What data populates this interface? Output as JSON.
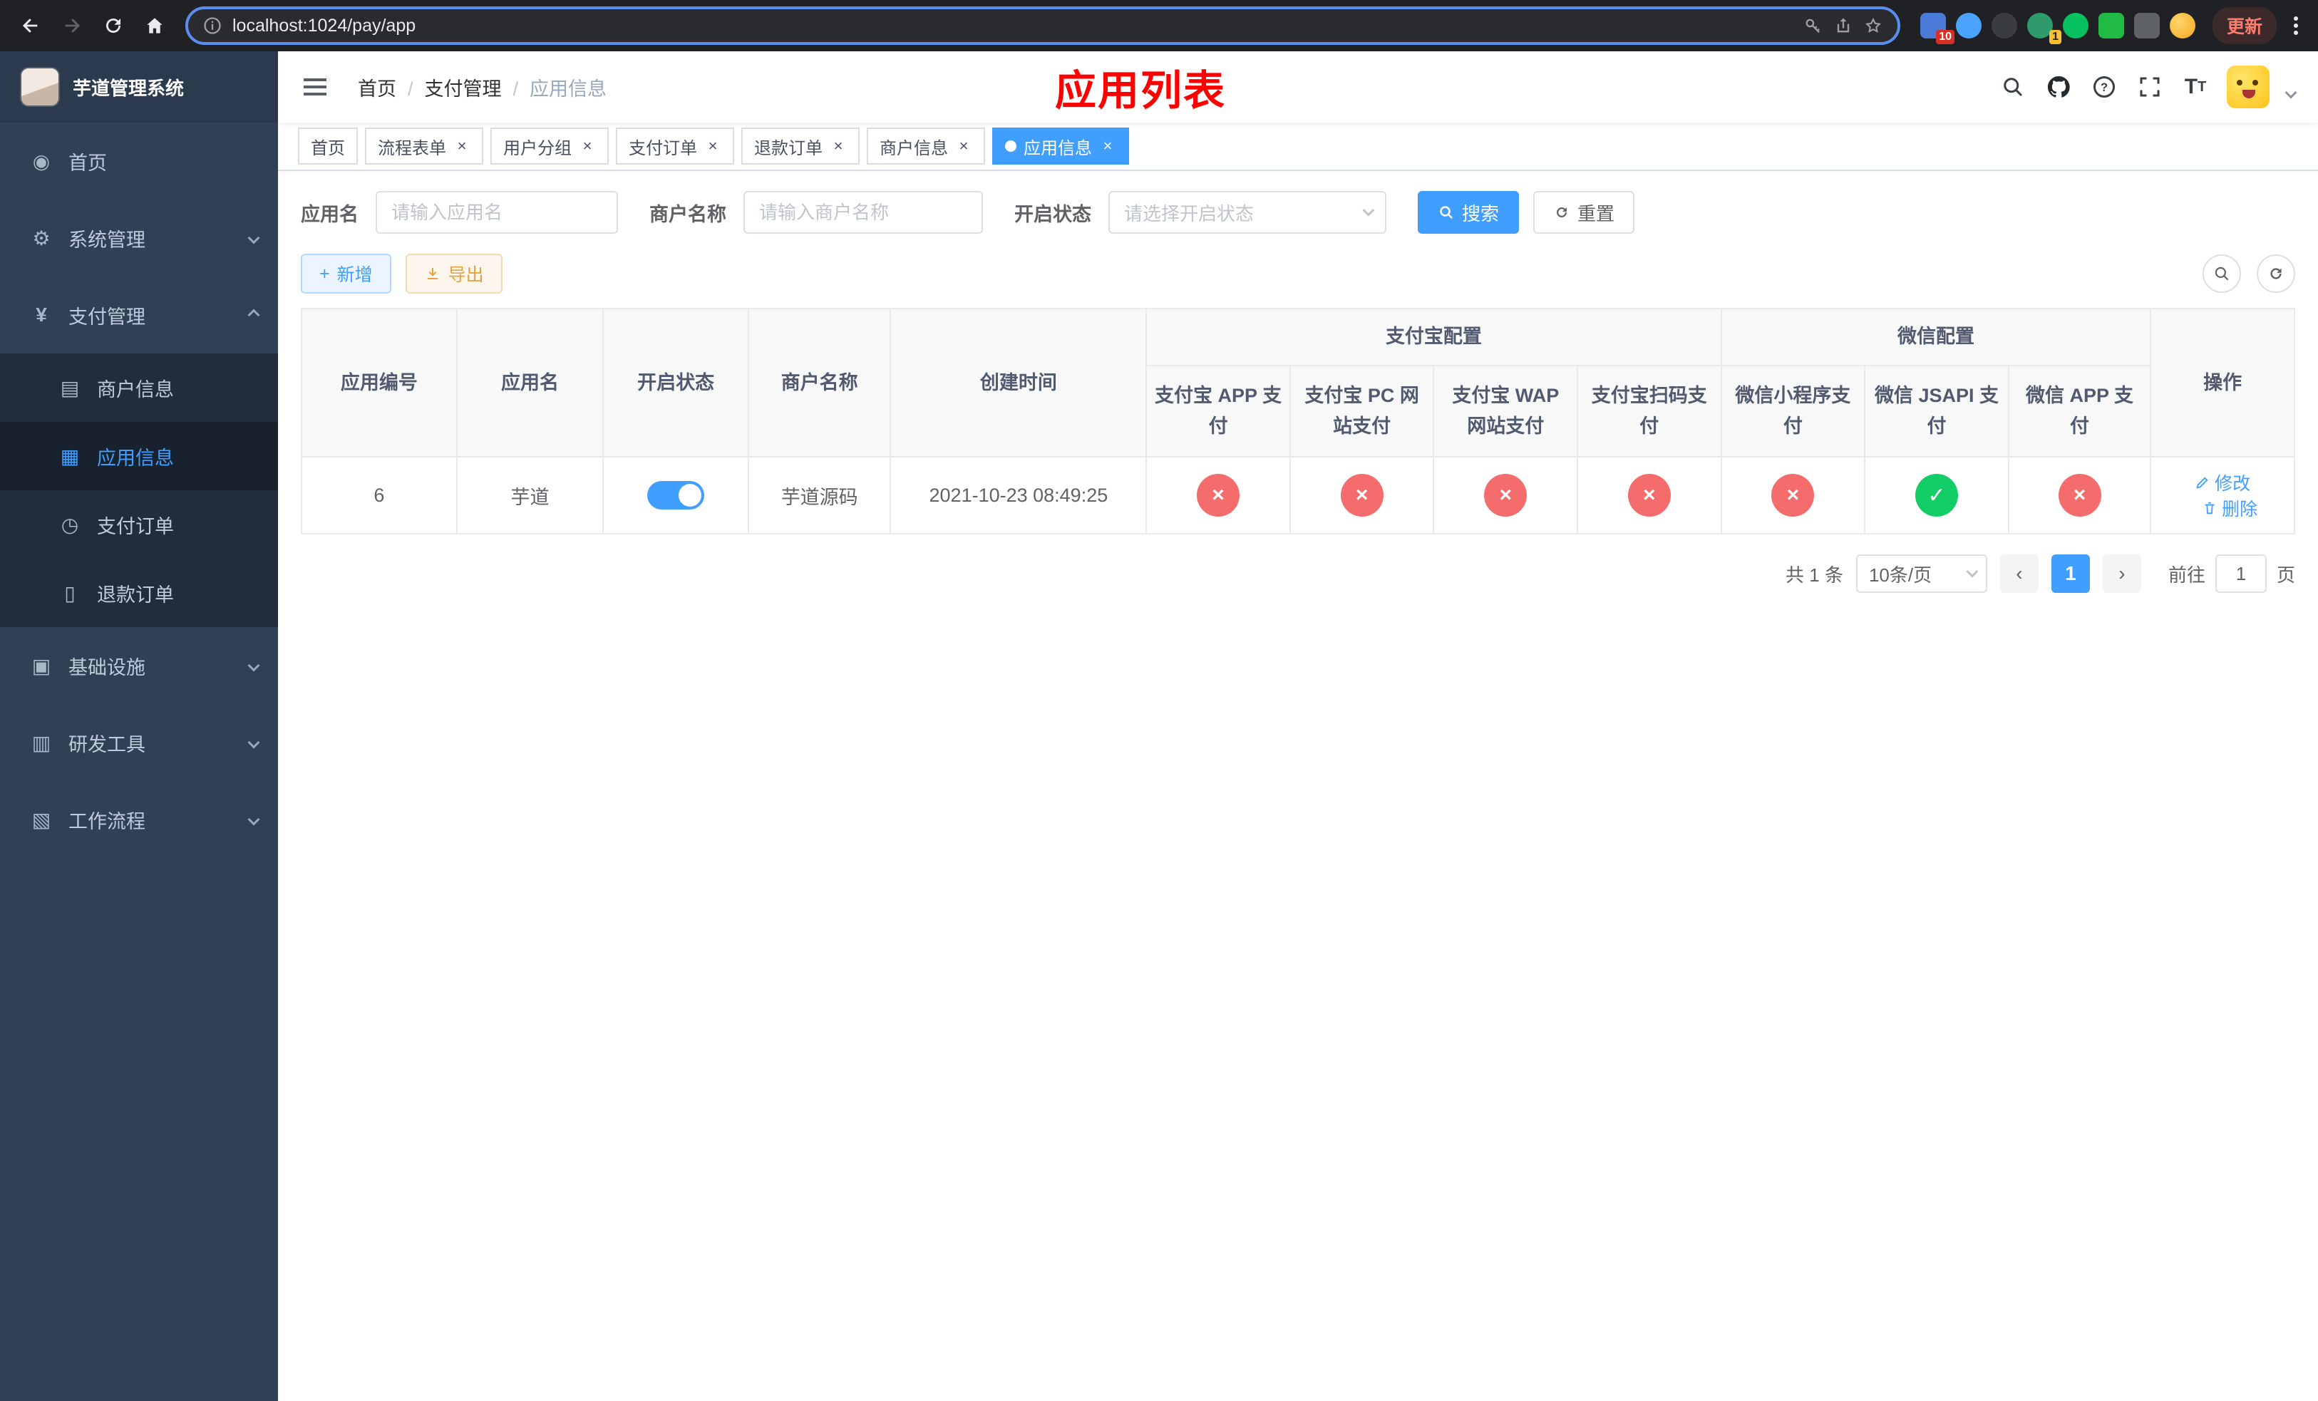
{
  "colors": {
    "accent": "#409eff",
    "danger": "#f56c6c",
    "success": "#13ce66",
    "warning": "#e6a23c",
    "sidebar_bg": "#304156",
    "submenu_bg": "#1f2d3d"
  },
  "browser": {
    "url": "localhost:1024/pay/app",
    "update_label": "更新",
    "ext_badge_a": "10",
    "ext_badge_b": "1"
  },
  "sidebar": {
    "title": "芋道管理系统",
    "items": [
      {
        "label": "首页"
      },
      {
        "label": "系统管理"
      },
      {
        "label": "支付管理"
      },
      {
        "label": "基础设施"
      },
      {
        "label": "研发工具"
      },
      {
        "label": "工作流程"
      }
    ],
    "submenu": [
      {
        "label": "商户信息"
      },
      {
        "label": "应用信息"
      },
      {
        "label": "支付订单"
      },
      {
        "label": "退款订单"
      }
    ]
  },
  "header": {
    "breadcrumb": [
      "首页",
      "支付管理",
      "应用信息"
    ],
    "annotation": "应用列表"
  },
  "tabs": [
    {
      "label": "首页"
    },
    {
      "label": "流程表单"
    },
    {
      "label": "用户分组"
    },
    {
      "label": "支付订单"
    },
    {
      "label": "退款订单"
    },
    {
      "label": "商户信息"
    },
    {
      "label": "应用信息"
    }
  ],
  "filters": {
    "app_name_label": "应用名",
    "app_name_placeholder": "请输入应用名",
    "merchant_label": "商户名称",
    "merchant_placeholder": "请输入商户名称",
    "status_label": "开启状态",
    "status_placeholder": "请选择开启状态",
    "search_button": "搜索",
    "reset_button": "重置"
  },
  "toolbar": {
    "add_button": "新增",
    "export_button": "导出"
  },
  "table": {
    "groups": {
      "alipay": "支付宝配置",
      "wechat": "微信配置"
    },
    "columns": [
      "应用编号",
      "应用名",
      "开启状态",
      "商户名称",
      "创建时间",
      "支付宝 APP 支付",
      "支付宝 PC 网站支付",
      "支付宝 WAP 网站支付",
      "支付宝扫码支付",
      "微信小程序支付",
      "微信 JSAPI 支付",
      "微信 APP 支付",
      "操作"
    ],
    "row": {
      "id": "6",
      "name": "芋道",
      "enabled": true,
      "merchant": "芋道源码",
      "created": "2021-10-23 08:49:25",
      "channels": [
        false,
        false,
        false,
        false,
        false,
        true,
        false
      ],
      "edit": "修改",
      "remove": "删除"
    }
  },
  "pagination": {
    "total": "共 1 条",
    "page_size": "10条/页",
    "page": "1",
    "goto_label": "前往",
    "goto_value": "1",
    "unit": "页"
  }
}
